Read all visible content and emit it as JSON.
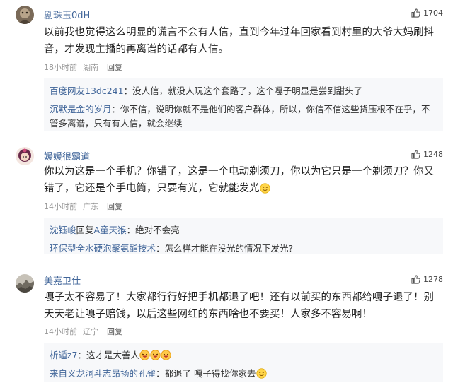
{
  "comments": [
    {
      "username": "剧珠玉0dH",
      "likes": "1704",
      "text": "以前我也觉得这么明显的谎言不会有人信，直到今年过年回家看到村里的大爷大妈刷抖音，才发现主播的再离谱的话都有人信。",
      "time": "18小时前",
      "location": "湖南",
      "reply_label": "回复",
      "replies": [
        {
          "user": "百度网友13dc241",
          "text": "没人信，就没人玩这个套路了，这个嘎子明显是尝到甜头了"
        },
        {
          "user": "沉默是金的岁月",
          "text": "你不信，说明你就不是他们的客户群体，所以，你信不信这些货压根不在乎，不管多离谱，只有有人信，就会继续"
        }
      ]
    },
    {
      "username": "媛媛很霸道",
      "likes": "1248",
      "text": "你以为这是一个手机？你错了，这是一个电动剃须刀，你以为它只是一个剃须刀？你又错了，它还是个手电筒，只要有光，它就能发光",
      "time": "14小时前",
      "location": "广东",
      "reply_label": "回复",
      "replies": [
        {
          "user": "沈钰峻",
          "mid": "回复",
          "target": "A童天猴",
          "text": "绝对不会亮"
        },
        {
          "user": "环保型全水硬泡聚氨酯技术",
          "text": "怎么样才能在没光的情况下发光?"
        }
      ]
    },
    {
      "username": "美嘉卫仕",
      "likes": "1278",
      "text": "嘎子太不容易了！大家都行行好把手机都退了吧！还有以前买的东西都给嘎子退了！别天天老让嘎子赔钱，以后这些网红的东西啥也不要买！人家多不容易啊！",
      "time": "14小时前",
      "location": "辽宁",
      "reply_label": "回复",
      "replies": [
        {
          "user": "析遁z7",
          "text": "这才是大善人"
        },
        {
          "user": "来自义龙洞斗志昂扬的孔雀",
          "text": "都退了 嘎子得找你家去"
        }
      ]
    }
  ],
  "colors": {
    "username": "#406599",
    "meta": "#999999",
    "reply_bg": "#f7f8fa",
    "text": "#222222"
  },
  "icons": {
    "like": "thumbs-up-icon",
    "smile_emoji": "smiling-face-emoji",
    "laugh_emoji": "laughing-face-emoji"
  }
}
